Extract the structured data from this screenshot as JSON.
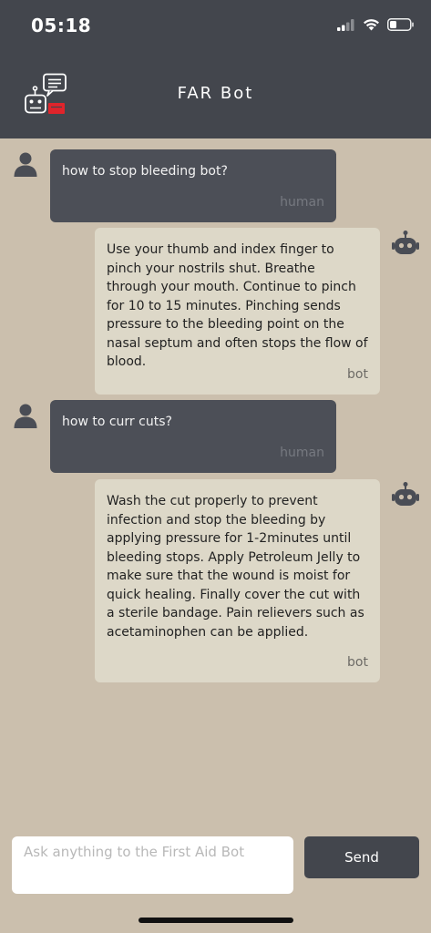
{
  "status_bar": {
    "time": "05:18",
    "icons": [
      "cellular-signal-icon",
      "wifi-icon",
      "battery-icon"
    ]
  },
  "header": {
    "title": "FAR Bot",
    "logo_icon": "robot-chat-logo-icon"
  },
  "messages": [
    {
      "role": "human",
      "text": "how to stop bleeding bot?",
      "label": "human"
    },
    {
      "role": "bot",
      "text": "Use your thumb and index finger to pinch your nostrils shut. Breathe through your mouth. Continue to pinch for 10 to 15 minutes. Pinching sends pressure to the bleeding point on the nasal septum and often stops the flow of blood.",
      "label": "bot"
    },
    {
      "role": "human",
      "text": "how to curr cuts?",
      "label": "human"
    },
    {
      "role": "bot",
      "text": "Wash the cut properly to prevent infection and stop the bleeding by applying pressure for 1-2minutes until bleeding stops. Apply Petroleum Jelly to make sure that the wound is moist for quick healing. Finally cover the cut with a sterile bandage. Pain relievers such as acetaminophen can be applied.",
      "label": "bot"
    }
  ],
  "composer": {
    "placeholder": "Ask anything to the First Aid Bot",
    "value": "",
    "send_label": "Send"
  },
  "colors": {
    "header": "#43464d",
    "background": "#cbbfad",
    "human_bubble": "#4c4f57",
    "bot_bubble": "#ddd8c8",
    "logo_accent": "#e0242b"
  }
}
